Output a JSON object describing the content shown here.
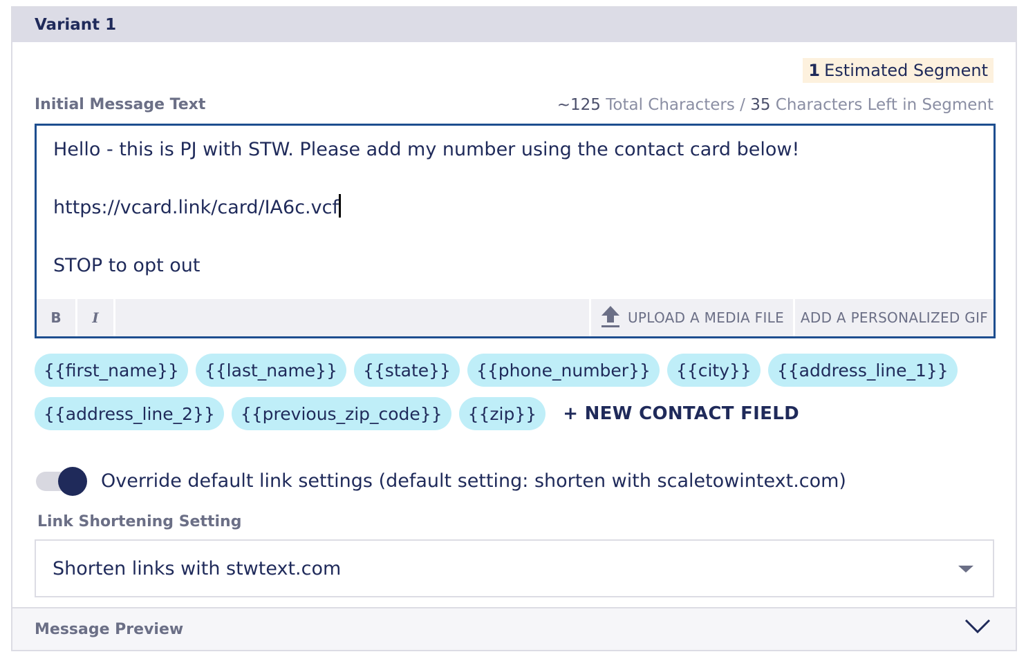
{
  "panel": {
    "title": "Variant 1"
  },
  "segment": {
    "count": "1",
    "label": "Estimated Segment"
  },
  "message": {
    "label": "Initial Message Text",
    "char_total": "~125",
    "char_total_label": "Total Characters /",
    "char_left": "35",
    "char_left_label": "Characters Left in Segment",
    "line1": "Hello - this is PJ with STW. Please add my number using the contact card below!",
    "line2": "https://vcard.link/card/IA6c.vcf",
    "line3": "STOP to opt out"
  },
  "toolbar": {
    "bold": "B",
    "italic": "I",
    "upload": "UPLOAD A MEDIA FILE",
    "gif": "ADD A PERSONALIZED GIF"
  },
  "fields": {
    "row1": [
      "{{first_name}}",
      "{{last_name}}",
      "{{state}}",
      "{{phone_number}}",
      "{{city}}",
      "{{address_line_1}}"
    ],
    "row2": [
      "{{address_line_2}}",
      "{{previous_zip_code}}",
      "{{zip}}"
    ],
    "new_field": "+ NEW CONTACT FIELD"
  },
  "link_override": {
    "enabled": true,
    "label": "Override default link settings (default setting: shorten with scaletowintext.com)"
  },
  "link_shortening": {
    "label": "Link Shortening Setting",
    "selected": "Shorten links with stwtext.com"
  },
  "preview": {
    "title": "Message Preview"
  },
  "colors": {
    "accent": "#1f2a5a",
    "chip": "#bfeef8",
    "editor_border": "#1d4e8f",
    "badge": "#fdf1de"
  },
  "icons": {
    "upload": "upload-icon",
    "dropdown": "caret-down-icon",
    "preview_toggle": "chevron-down-icon"
  }
}
